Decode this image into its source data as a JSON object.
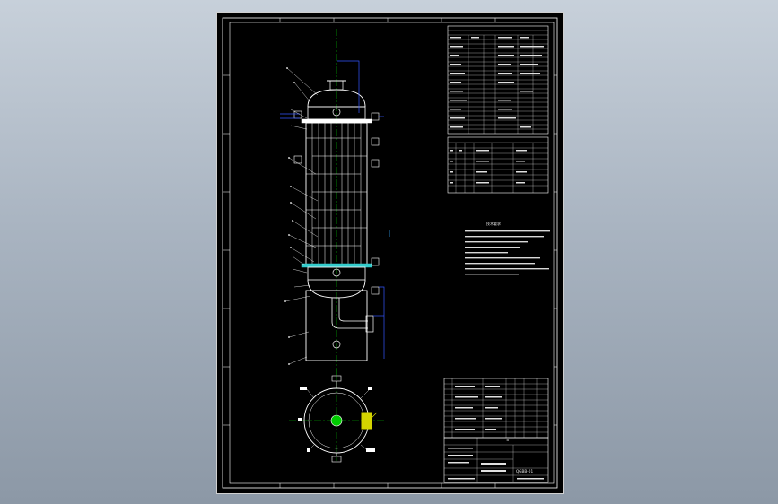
{
  "viewer": {
    "background": "gradient-grey-blue"
  },
  "drawing": {
    "title_block": {
      "part_number": "QGBB-01",
      "sheet_label": "Ｂ"
    },
    "notes_title": "技术要求",
    "colors": {
      "background": "#000000",
      "outline": "#ffffff",
      "centerline": "#00cc00",
      "dimension": "#3355ff",
      "accent": "#d4d400"
    }
  }
}
